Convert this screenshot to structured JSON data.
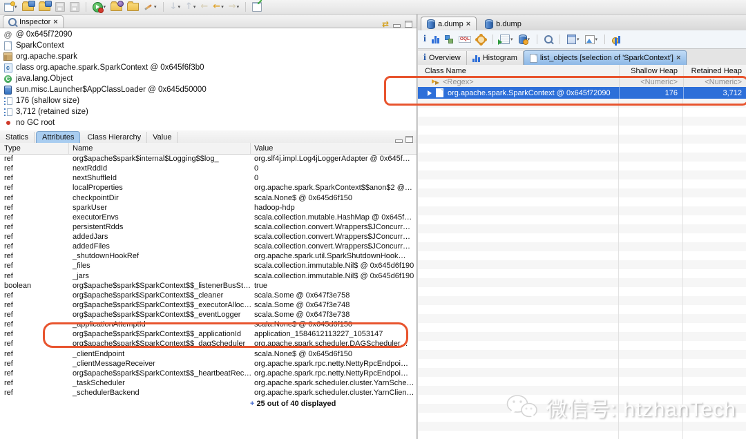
{
  "icons": {
    "dropdown": "▾",
    "close": "×",
    "sync": "⇄",
    "back": "←",
    "forward": "→",
    "up": "↑",
    "down": "↓",
    "at": "@",
    "info": "i",
    "class_letter": "c",
    "superclass_letter": "C"
  },
  "inspector": {
    "tab_title": "Inspector",
    "items": [
      {
        "icon": "address-icon",
        "label": "@ 0x645f72090"
      },
      {
        "icon": "object-icon",
        "label": "SparkContext"
      },
      {
        "icon": "package-icon",
        "label": "org.apache.spark"
      },
      {
        "icon": "class-icon",
        "label": "class org.apache.spark.SparkContext @ 0x645f6f3b0"
      },
      {
        "icon": "superclass-icon",
        "label": "java.lang.Object"
      },
      {
        "icon": "classloader-icon",
        "label": "sun.misc.Launcher$AppClassLoader @ 0x645d50000"
      },
      {
        "icon": "shallow-size-icon",
        "label": "176 (shallow size)"
      },
      {
        "icon": "retained-size-icon",
        "label": "3,712 (retained size)"
      },
      {
        "icon": "gc-root-icon",
        "label": "no GC root"
      }
    ]
  },
  "attributes_panel": {
    "tabs": [
      "Statics",
      "Attributes",
      "Class Hierarchy",
      "Value"
    ],
    "active_tab": "Attributes",
    "columns": [
      "Type",
      "Name",
      "Value"
    ],
    "rows": [
      {
        "type": "ref",
        "name": "org$apache$spark$internal$Logging$$log_",
        "value": "org.slf4j.impl.Log4jLoggerAdapter @ 0x645f…"
      },
      {
        "type": "ref",
        "name": "nextRddId",
        "value": "0"
      },
      {
        "type": "ref",
        "name": "nextShuffleId",
        "value": "0"
      },
      {
        "type": "ref",
        "name": "localProperties",
        "value": "org.apache.spark.SparkContext$$anon$2 @…"
      },
      {
        "type": "ref",
        "name": "checkpointDir",
        "value": "scala.None$ @ 0x645d6f150"
      },
      {
        "type": "ref",
        "name": "sparkUser",
        "value": "hadoop-hdp"
      },
      {
        "type": "ref",
        "name": "executorEnvs",
        "value": "scala.collection.mutable.HashMap @ 0x645f…"
      },
      {
        "type": "ref",
        "name": "persistentRdds",
        "value": "scala.collection.convert.Wrappers$JConcurr…"
      },
      {
        "type": "ref",
        "name": "addedJars",
        "value": "scala.collection.convert.Wrappers$JConcurr…"
      },
      {
        "type": "ref",
        "name": "addedFiles",
        "value": "scala.collection.convert.Wrappers$JConcurr…"
      },
      {
        "type": "ref",
        "name": "_shutdownHookRef",
        "value": "org.apache.spark.util.SparkShutdownHook…"
      },
      {
        "type": "ref",
        "name": "_files",
        "value": "scala.collection.immutable.Nil$ @ 0x645d6f190"
      },
      {
        "type": "ref",
        "name": "_jars",
        "value": "scala.collection.immutable.Nil$ @ 0x645d6f190"
      },
      {
        "type": "boolean",
        "name": "org$apache$spark$SparkContext$$_listenerBusSt…",
        "value": "true"
      },
      {
        "type": "ref",
        "name": "org$apache$spark$SparkContext$$_cleaner",
        "value": "scala.Some @ 0x647f3e758"
      },
      {
        "type": "ref",
        "name": "org$apache$spark$SparkContext$$_executorAlloc…",
        "value": "scala.Some @ 0x647f3e748"
      },
      {
        "type": "ref",
        "name": "org$apache$spark$SparkContext$$_eventLogger",
        "value": "scala.Some @ 0x647f3e738"
      },
      {
        "type": "ref",
        "name": "_applicationAttemptId",
        "value": "scala.None$ @ 0x645d6f150"
      },
      {
        "type": "ref",
        "name": "org$apache$spark$SparkContext$$_applicationId",
        "value": "application_1584612113227_1053147"
      },
      {
        "type": "ref",
        "name": "org$apache$spark$SparkContext$$_dagScheduler",
        "value": "org.apache.spark.scheduler.DAGScheduler…"
      },
      {
        "type": "ref",
        "name": "_clientEndpoint",
        "value": "scala.None$ @ 0x645d6f150"
      },
      {
        "type": "ref",
        "name": "_clientMessageReceiver",
        "value": "org.apache.spark.rpc.netty.NettyRpcEndpoi…"
      },
      {
        "type": "ref",
        "name": "org$apache$spark$SparkContext$$_heartbeatRec…",
        "value": "org.apache.spark.rpc.netty.NettyRpcEndpoi…"
      },
      {
        "type": "ref",
        "name": "_taskScheduler",
        "value": "org.apache.spark.scheduler.cluster.YarnSche…"
      },
      {
        "type": "ref",
        "name": "_schedulerBackend",
        "value": "org.apache.spark.scheduler.cluster.YarnClien…"
      }
    ],
    "footer": {
      "prefix": "+",
      "text": "25 out of 40 displayed"
    }
  },
  "editor": {
    "tabs": [
      {
        "label": "a.dump",
        "active": true
      },
      {
        "label": "b.dump",
        "active": false
      }
    ],
    "view_tabs": [
      "Overview",
      "Histogram",
      "list_objects  [selection of 'SparkContext']"
    ],
    "table": {
      "columns": [
        "Class Name",
        "Shallow Heap",
        "Retained Heap"
      ],
      "filter": {
        "class_name": "<Regex>",
        "shallow_heap": "<Numeric>",
        "retained_heap": "<Numeric>"
      },
      "selected": {
        "class_name": "org.apache.spark.SparkContext @ 0x645f72090",
        "shallow_heap": "176",
        "retained_heap": "3,712"
      }
    }
  },
  "watermark": {
    "text": "微信号: htzhanTech"
  },
  "colors": {
    "selection_blue": "#2d6fd9",
    "annotation_red": "#e8542e",
    "active_tab_blue": "#a9cdf0"
  }
}
